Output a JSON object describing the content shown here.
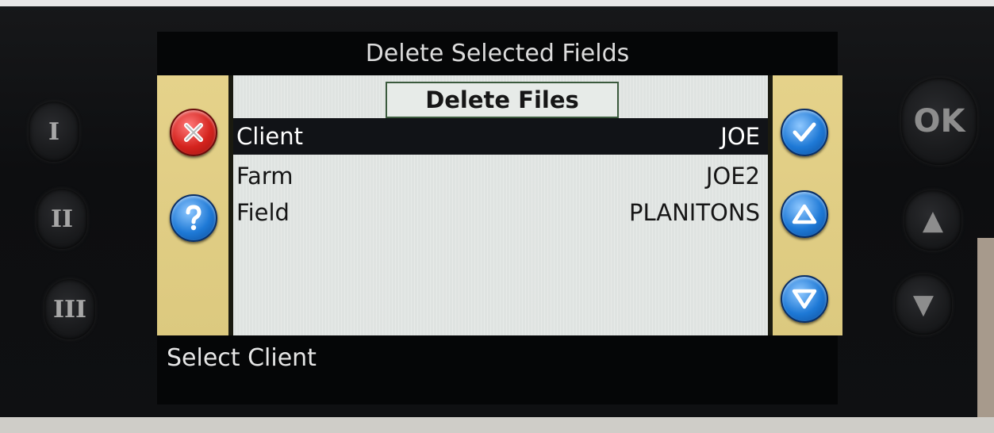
{
  "screen": {
    "title": "Delete Selected Fields",
    "pane_header": "Delete Files",
    "rows": [
      {
        "label": "Client",
        "value": "JOE",
        "selected": true
      },
      {
        "label": "Farm",
        "value": "JOE2",
        "selected": false
      },
      {
        "label": "Field",
        "value": "PLANITONS",
        "selected": false
      }
    ],
    "status": "Select Client"
  },
  "soft_buttons": {
    "cancel": "x-icon",
    "help": "question-icon",
    "confirm": "checkmark-icon",
    "up": "arrow-up-icon",
    "down": "arrow-down-icon"
  },
  "hardware": {
    "key1": "I",
    "key2": "II",
    "key3": "III",
    "ok": "OK",
    "up_glyph": "▲",
    "down_glyph": "▼"
  },
  "colors": {
    "side_panel": "#e5d28a",
    "selected_row": "#111317",
    "cancel_red": "#d4231e",
    "action_blue": "#1e79d6"
  }
}
